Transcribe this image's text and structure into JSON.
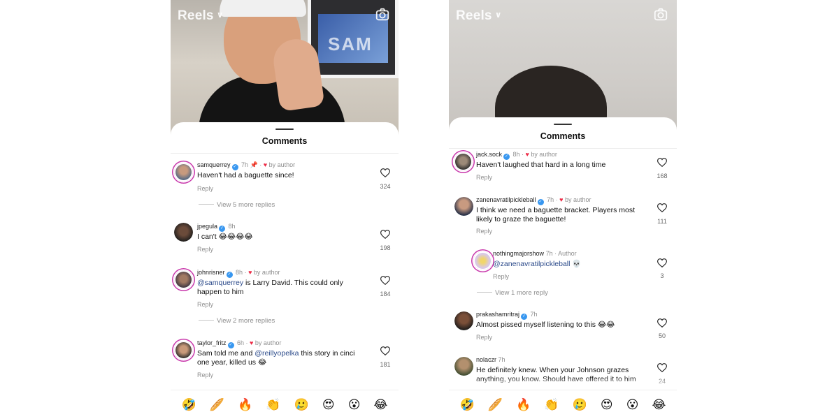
{
  "colors": {
    "verified": "#3897f0",
    "author_heart": "#ed2b46",
    "mention": "#2b4a8a",
    "story_ring": "#c837ab"
  },
  "left": {
    "header": {
      "title": "Reels",
      "chevron_icon": "chevron-down-icon",
      "camera_icon": "camera-icon"
    },
    "sheet_title": "Comments",
    "comments": [
      {
        "user": "samquerrey",
        "time": "7h",
        "pinned": true,
        "author_label": "by author",
        "text": "Haven't had a baguette since!",
        "reply": "Reply",
        "likes": "324",
        "more_replies": "View 5 more replies"
      },
      {
        "user": "jpegula",
        "time": "8h",
        "text": "I can't 😂😂😂😂",
        "reply": "Reply",
        "likes": "198"
      },
      {
        "user": "johnrisner",
        "time": "8h",
        "author_label": "by author",
        "mention": "@samquerrey",
        "text": " is Larry David. This could only happen to him",
        "reply": "Reply",
        "likes": "184",
        "more_replies": "View 2 more replies"
      },
      {
        "user": "taylor_fritz",
        "time": "6h",
        "author_label": "by author",
        "text_a": "Sam told me and ",
        "mention": "@reillyopelka",
        "text_b": " this story in cinci one year, killed us 😂",
        "reply": "Reply",
        "likes": "181"
      }
    ],
    "emojis": [
      "🤣",
      "🥖",
      "🔥",
      "👏",
      "🥲",
      "😍",
      "😮",
      "😂"
    ]
  },
  "right": {
    "header": {
      "title": "Reels",
      "chevron_icon": "chevron-down-icon",
      "camera_icon": "camera-icon"
    },
    "sheet_title": "Comments",
    "comments": [
      {
        "user": "jack.sock",
        "time": "8h",
        "author_label": "by author",
        "text": "Haven't laughed that hard in a long time",
        "reply": "Reply",
        "likes": "168"
      },
      {
        "user": "zanenavratilpickleball",
        "time": "7h",
        "author_label": "by author",
        "text": "I think we need a baguette bracket. Players most likely to graze the baguette!",
        "reply": "Reply",
        "likes": "111"
      },
      {
        "user": "nothingmajorshow",
        "time": "7h",
        "author_label": "Author",
        "mention": "@zanenavratilpickleball",
        "text": " 💀",
        "reply": "Reply",
        "likes": "3",
        "more_replies": "View 1 more reply"
      },
      {
        "user": "prakashamritraj",
        "time": "7h",
        "text": "Almost pissed myself listening to this 😂😂",
        "reply": "Reply",
        "likes": "50"
      },
      {
        "user": "nolaczr",
        "time": "7h",
        "text": "He definitely knew. When your Johnson grazes anything, you know. Should have offered it to him",
        "likes": "24"
      }
    ],
    "emojis": [
      "🤣",
      "🥖",
      "🔥",
      "👏",
      "🥲",
      "😍",
      "😮",
      "😂"
    ]
  }
}
